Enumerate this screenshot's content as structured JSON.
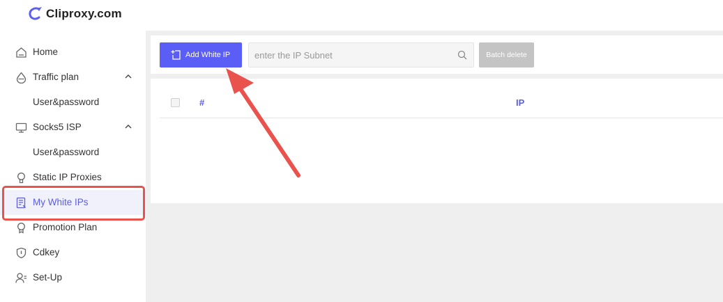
{
  "app": {
    "logo_text": "Cliproxy.com",
    "accent_color": "#5b5ef6",
    "highlight_color": "#e9524d"
  },
  "sidebar": {
    "items": [
      {
        "label": "Home",
        "icon": "home-icon"
      },
      {
        "label": "Traffic plan",
        "icon": "droplet-icon",
        "expanded": true
      },
      {
        "label": "User&password",
        "sub": true
      },
      {
        "label": "Socks5 ISP",
        "icon": "monitor-icon",
        "expanded": true
      },
      {
        "label": "User&password",
        "sub": true
      },
      {
        "label": "Static IP Proxies",
        "icon": "location-pin-icon"
      },
      {
        "label": "My White IPs",
        "icon": "document-list-icon",
        "active": true
      },
      {
        "label": "Promotion Plan",
        "icon": "badge-icon"
      },
      {
        "label": "Cdkey",
        "icon": "shield-icon"
      },
      {
        "label": "Set-Up",
        "icon": "user-settings-icon"
      }
    ]
  },
  "toolbar": {
    "add_label": "Add White IP",
    "search_placeholder": "enter the IP Subnet",
    "search_value": "",
    "batch_delete_label": "Batch delete"
  },
  "table": {
    "columns": [
      "#",
      "IP"
    ],
    "rows": []
  }
}
